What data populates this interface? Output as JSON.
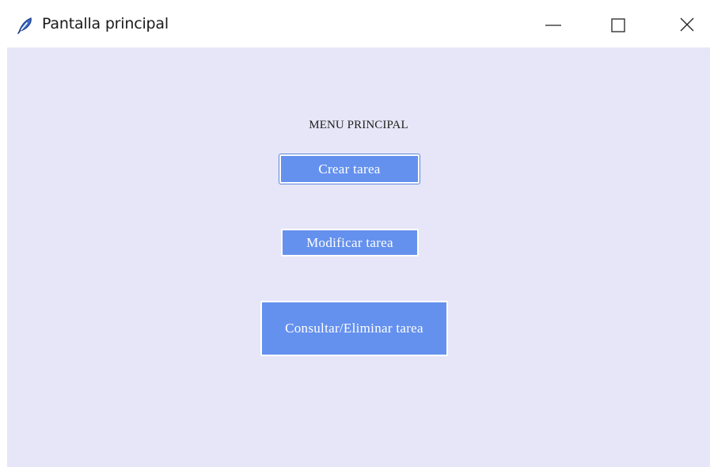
{
  "window": {
    "title": "Pantalla principal",
    "icon": "feather-pen-icon",
    "controls": [
      "minimize",
      "maximize",
      "close"
    ]
  },
  "menu": {
    "title": "MENU PRINCIPAL",
    "buttons": {
      "crear": "Crear tarea",
      "modificar": "Modificar tarea",
      "consultar": "Consultar/Eliminar tarea"
    }
  },
  "colors": {
    "background": "#e6e6f8",
    "button": "#6591ee",
    "button_text": "#ffffff",
    "focus_ring": "#5b86db"
  }
}
